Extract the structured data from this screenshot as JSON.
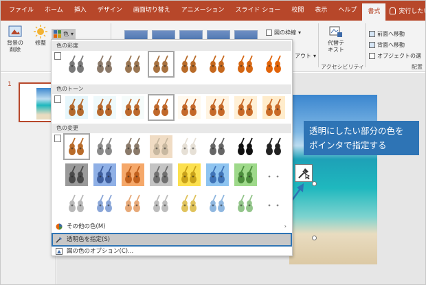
{
  "tabs": [
    {
      "label": "ファイル",
      "active": false
    },
    {
      "label": "ホーム",
      "active": false
    },
    {
      "label": "挿入",
      "active": false
    },
    {
      "label": "デザイン",
      "active": false
    },
    {
      "label": "画面切り替え",
      "active": false
    },
    {
      "label": "アニメーション",
      "active": false
    },
    {
      "label": "スライド ショー",
      "active": false
    },
    {
      "label": "校閲",
      "active": false
    },
    {
      "label": "表示",
      "active": false
    },
    {
      "label": "ヘルプ",
      "active": false
    },
    {
      "label": "書式",
      "active": true
    }
  ],
  "tell_me": "実行したい作業",
  "ribbon": {
    "remove_bg_line1": "背景の",
    "remove_bg_line2": "削除",
    "corrections": "修整",
    "color": "色",
    "picture_border": "図の枠線",
    "alt_text_line1": "代替テ",
    "alt_text_line2": "キスト",
    "accessibility": "アクセシビリティ",
    "bring_forward": "前面へ移動",
    "send_backward": "背面へ移動",
    "selection_pane": "オブジェクトの選",
    "arrange": "配置",
    "layout_partial": "アウト"
  },
  "slide_pane": {
    "number": "1"
  },
  "dropdown": {
    "saturation_header": "色の彩度",
    "tone_header": "色のトーン",
    "recolor_header": "色の変更",
    "more_colors": "その他の色(M)",
    "set_transparent": "透明色を指定(S)",
    "picture_color_options": "図の色のオプション(C)..."
  },
  "swatch_colors": {
    "saturation": [
      "#7a7a7a",
      "#8c7a6a",
      "#9a7652",
      "#a87240",
      "#b96c2a",
      "#c7691e",
      "#d56612",
      "#e2640a"
    ],
    "saturation_bg": [
      "#ffffff",
      "#ffffff",
      "#ffffff",
      "#ffffff",
      "#ffffff",
      "#ffffff",
      "#ffffff",
      "#ffffff"
    ],
    "tone": [
      "#b46a2e",
      "#b8692d",
      "#bc692c",
      "#c0682b",
      "#c4682a",
      "#c66929",
      "#c86a28",
      "#ca6b27"
    ],
    "tone_bg": [
      "#e6f6fb",
      "#eef9fb",
      "#f5fbfa",
      "#ffffff",
      "#fff9ee",
      "#fff4e2",
      "#fff0d6",
      "#ffeccb"
    ],
    "recolor_row1": [
      "#b96c2a",
      "#8a8a8a",
      "#8a7a6a",
      "#c8b8a0",
      "#e6e0d6",
      "#666666",
      "#111111",
      "#222222"
    ],
    "recolor_row1_bg": [
      "#ffffff",
      "#ffffff",
      "#ffffff",
      "#f0dcc4",
      "#ffffff",
      "#ffffff",
      "#ffffff",
      "#ffffff"
    ],
    "recolor_row2": [
      "#4a4a4a",
      "#3f5f9f",
      "#c2611d",
      "#707070",
      "#c9a21a",
      "#3f74b8",
      "#4c8e3c",
      "#ffffff"
    ],
    "recolor_row2_bg": [
      "#9a9a9a",
      "#8fb0e6",
      "#f5a86a",
      "#c4c4c4",
      "#fce04e",
      "#8ec4f0",
      "#9ed98a",
      "#ffffff"
    ],
    "recolor_row3": [
      "#b9b9b9",
      "#8aa6d8",
      "#e7a978",
      "#bdbdbd",
      "#e0c35c",
      "#8fb7e0",
      "#93c58a",
      "#ffffff"
    ],
    "recolor_row3_bg": [
      "#ffffff",
      "#ffffff",
      "#ffffff",
      "#ffffff",
      "#ffffff",
      "#ffffff",
      "#ffffff",
      "#ffffff"
    ]
  },
  "callout": {
    "line1": "透明にしたい部分の色を",
    "line2": "ポインタで指定する"
  },
  "accent": "#b7472a",
  "highlight": "#2e74b5"
}
